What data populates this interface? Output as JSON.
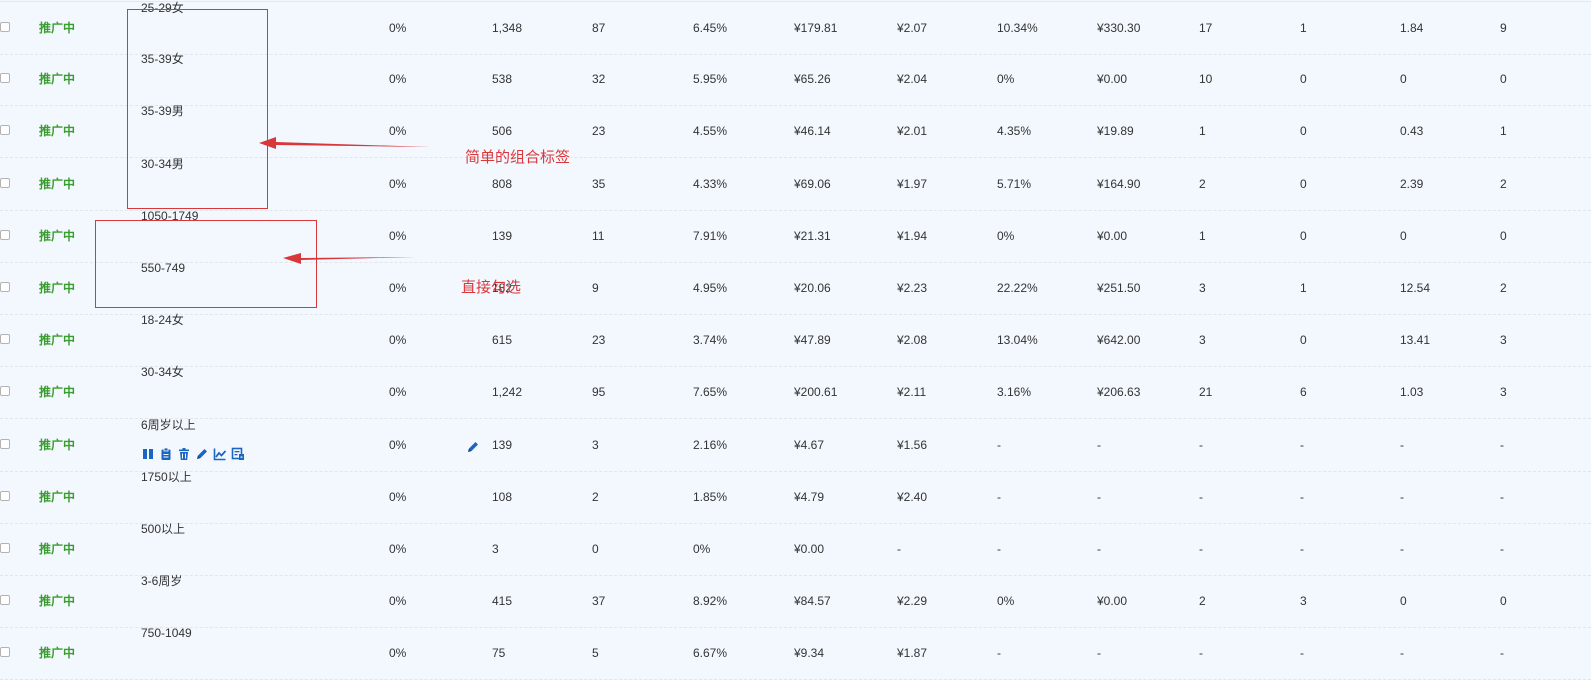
{
  "columns": [
    "tag",
    "status",
    "bid_ratio",
    "impressions",
    "clicks",
    "ctr",
    "cost",
    "cpc",
    "conv_rate",
    "revenue",
    "favorites",
    "orders",
    "roi",
    "carts"
  ],
  "rows": [
    {
      "status": "推广中",
      "tag": "25-29女",
      "bid_ratio": "0%",
      "impressions": "1,348",
      "clicks": "87",
      "ctr": "6.45%",
      "cost": "¥179.81",
      "cpc": "¥2.07",
      "conv_rate": "10.34%",
      "revenue": "¥330.30",
      "favorites": "17",
      "orders": "1",
      "roi": "1.84",
      "carts": "9"
    },
    {
      "status": "推广中",
      "tag": "35-39女",
      "bid_ratio": "0%",
      "impressions": "538",
      "clicks": "32",
      "ctr": "5.95%",
      "cost": "¥65.26",
      "cpc": "¥2.04",
      "conv_rate": "0%",
      "revenue": "¥0.00",
      "favorites": "10",
      "orders": "0",
      "roi": "0",
      "carts": "0"
    },
    {
      "status": "推广中",
      "tag": "35-39男",
      "bid_ratio": "0%",
      "impressions": "506",
      "clicks": "23",
      "ctr": "4.55%",
      "cost": "¥46.14",
      "cpc": "¥2.01",
      "conv_rate": "4.35%",
      "revenue": "¥19.89",
      "favorites": "1",
      "orders": "0",
      "roi": "0.43",
      "carts": "1"
    },
    {
      "status": "推广中",
      "tag": "30-34男",
      "bid_ratio": "0%",
      "impressions": "808",
      "clicks": "35",
      "ctr": "4.33%",
      "cost": "¥69.06",
      "cpc": "¥1.97",
      "conv_rate": "5.71%",
      "revenue": "¥164.90",
      "favorites": "2",
      "orders": "0",
      "roi": "2.39",
      "carts": "2"
    },
    {
      "status": "推广中",
      "tag": "1050-1749",
      "bid_ratio": "0%",
      "impressions": "139",
      "clicks": "11",
      "ctr": "7.91%",
      "cost": "¥21.31",
      "cpc": "¥1.94",
      "conv_rate": "0%",
      "revenue": "¥0.00",
      "favorites": "1",
      "orders": "0",
      "roi": "0",
      "carts": "0"
    },
    {
      "status": "推广中",
      "tag": "550-749",
      "bid_ratio": "0%",
      "impressions": "182",
      "clicks": "9",
      "ctr": "4.95%",
      "cost": "¥20.06",
      "cpc": "¥2.23",
      "conv_rate": "22.22%",
      "revenue": "¥251.50",
      "favorites": "3",
      "orders": "1",
      "roi": "12.54",
      "carts": "2"
    },
    {
      "status": "推广中",
      "tag": "18-24女",
      "bid_ratio": "0%",
      "impressions": "615",
      "clicks": "23",
      "ctr": "3.74%",
      "cost": "¥47.89",
      "cpc": "¥2.08",
      "conv_rate": "13.04%",
      "revenue": "¥642.00",
      "favorites": "3",
      "orders": "0",
      "roi": "13.41",
      "carts": "3"
    },
    {
      "status": "推广中",
      "tag": "30-34女",
      "bid_ratio": "0%",
      "impressions": "1,242",
      "clicks": "95",
      "ctr": "7.65%",
      "cost": "¥200.61",
      "cpc": "¥2.11",
      "conv_rate": "3.16%",
      "revenue": "¥206.63",
      "favorites": "21",
      "orders": "6",
      "roi": "1.03",
      "carts": "3"
    },
    {
      "status": "推广中",
      "tag": "6周岁以上",
      "bid_ratio": "0%",
      "impressions": "139",
      "clicks": "3",
      "ctr": "2.16%",
      "cost": "¥4.67",
      "cpc": "¥1.56",
      "conv_rate": "-",
      "revenue": "-",
      "favorites": "-",
      "orders": "-",
      "roi": "-",
      "carts": "-"
    },
    {
      "status": "推广中",
      "tag": "1750以上",
      "bid_ratio": "0%",
      "impressions": "108",
      "clicks": "2",
      "ctr": "1.85%",
      "cost": "¥4.79",
      "cpc": "¥2.40",
      "conv_rate": "-",
      "revenue": "-",
      "favorites": "-",
      "orders": "-",
      "roi": "-",
      "carts": "-"
    },
    {
      "status": "推广中",
      "tag": "500以上",
      "bid_ratio": "0%",
      "impressions": "3",
      "clicks": "0",
      "ctr": "0%",
      "cost": "¥0.00",
      "cpc": "-",
      "conv_rate": "-",
      "revenue": "-",
      "favorites": "-",
      "orders": "-",
      "roi": "-",
      "carts": "-"
    },
    {
      "status": "推广中",
      "tag": "3-6周岁",
      "bid_ratio": "0%",
      "impressions": "415",
      "clicks": "37",
      "ctr": "8.92%",
      "cost": "¥84.57",
      "cpc": "¥2.29",
      "conv_rate": "0%",
      "revenue": "¥0.00",
      "favorites": "2",
      "orders": "3",
      "roi": "0",
      "carts": "0"
    },
    {
      "status": "推广中",
      "tag": "750-1049",
      "bid_ratio": "0%",
      "impressions": "75",
      "clicks": "5",
      "ctr": "6.67%",
      "cost": "¥9.34",
      "cpc": "¥1.87",
      "conv_rate": "-",
      "revenue": "-",
      "favorites": "-",
      "orders": "-",
      "roi": "-",
      "carts": "-"
    }
  ],
  "hover_row_icons": [
    "pause-icon",
    "clipboard-icon",
    "trash-icon",
    "edit-icon",
    "trend-chart-icon",
    "report-icon"
  ],
  "annotations": {
    "combo_note": "简单的组合标签",
    "direct_note": "直接勾选"
  },
  "colors": {
    "status_green": "#3a9d2f",
    "annotation_red": "#d9383b",
    "icon_blue": "#1a66c2",
    "background": "#f3f8fe"
  }
}
